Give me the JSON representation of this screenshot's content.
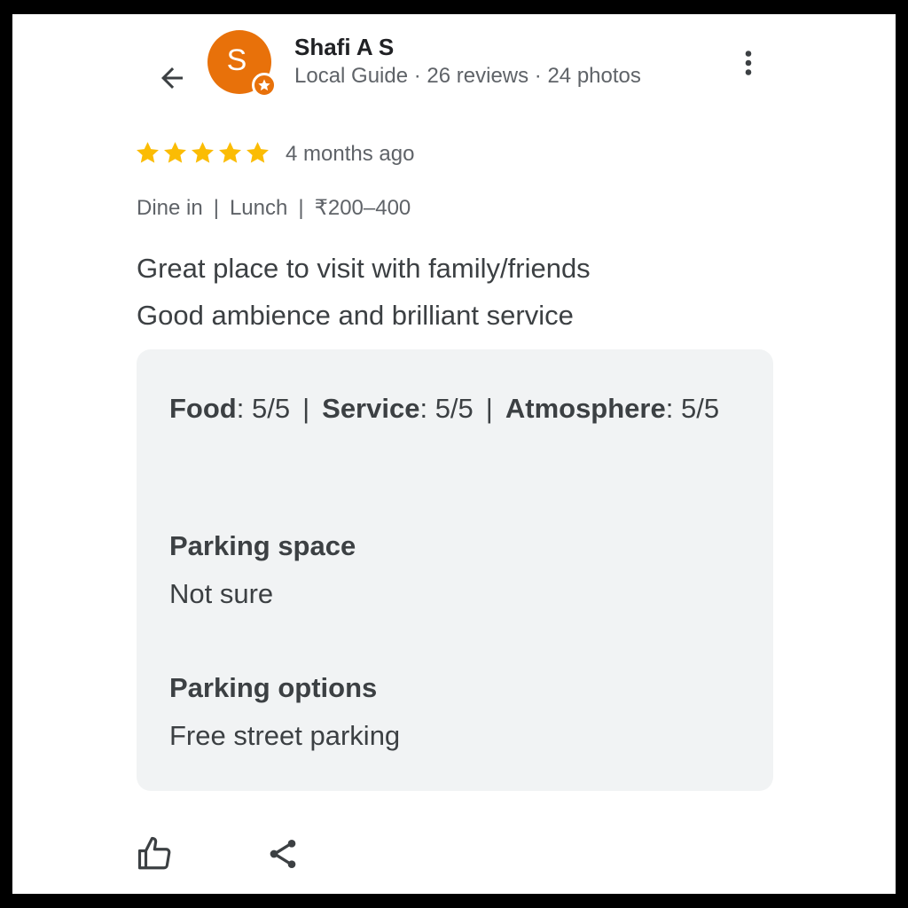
{
  "header": {
    "back_icon": "arrow-left-icon",
    "avatar_letter": "S",
    "avatar_color": "#e8710a",
    "badge_icon": "local-guide-star-icon",
    "reviewer_name": "Shafi A S",
    "reviewer_meta": "Local Guide · 26 reviews · 24 photos",
    "more_icon": "more-vert-icon"
  },
  "review": {
    "rating": 5,
    "rating_max": 5,
    "star_color": "#fbbc04",
    "time_ago": "4 months ago",
    "tags": [
      "Dine in",
      "Lunch",
      "₹200–400"
    ],
    "text_line1": "Great place to visit with family/friends",
    "text_line2": "Good ambience and brilliant service"
  },
  "details": {
    "ratings": [
      {
        "label": "Food",
        "value": ": 5/5"
      },
      {
        "label": "Service",
        "value": ": 5/5"
      },
      {
        "label": "Atmosphere",
        "value": ": 5/5"
      }
    ],
    "separator": "|",
    "parking_space_label": "Parking space",
    "parking_space_value": "Not sure",
    "parking_options_label": "Parking options",
    "parking_options_value": "Free street parking"
  },
  "actions": {
    "like_icon": "thumbs-up-icon",
    "share_icon": "share-icon"
  }
}
